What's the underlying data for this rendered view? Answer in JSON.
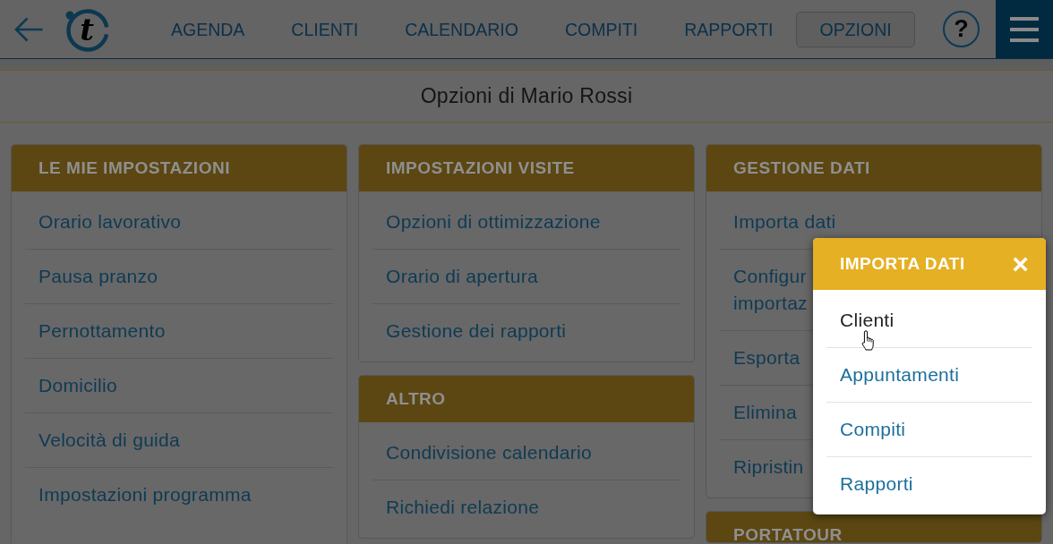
{
  "nav": {
    "logo": "t",
    "items": [
      {
        "label": "AGENDA",
        "selected": false
      },
      {
        "label": "CLIENTI",
        "selected": false
      },
      {
        "label": "CALENDARIO",
        "selected": false
      },
      {
        "label": "COMPITI",
        "selected": false
      },
      {
        "label": "RAPPORTI",
        "selected": false
      },
      {
        "label": "OPZIONI",
        "selected": true
      }
    ],
    "help": "?"
  },
  "page_title": "Opzioni di Mario Rossi",
  "columns": [
    {
      "cards": [
        {
          "title": "LE MIE IMPOSTAZIONI",
          "items": [
            "Orario lavorativo",
            "Pausa pranzo",
            "Pernottamento",
            "Domicilio",
            "Velocità di guida",
            "Impostazioni programma"
          ]
        }
      ]
    },
    {
      "cards": [
        {
          "title": "IMPOSTAZIONI VISITE",
          "items": [
            "Opzioni di ottimizzazione",
            "Orario di apertura",
            "Gestione dei rapporti"
          ]
        },
        {
          "title": "ALTRO",
          "items": [
            "Condivisione calendario",
            "Richiedi relazione"
          ]
        }
      ]
    },
    {
      "cards": [
        {
          "title": "GESTIONE DATI",
          "items": [
            "Importa dati",
            "Configur\nimportaz",
            "Esporta",
            "Elimina",
            "Ripristin"
          ]
        },
        {
          "title": "PORTATOUR"
        }
      ]
    }
  ],
  "popup": {
    "title": "IMPORTA DATI",
    "close": "×",
    "items": [
      {
        "label": "Clienti",
        "hovered": true
      },
      {
        "label": "Appuntamenti",
        "hovered": false
      },
      {
        "label": "Compiti",
        "hovered": false
      },
      {
        "label": "Rapporti",
        "hovered": false
      }
    ]
  }
}
